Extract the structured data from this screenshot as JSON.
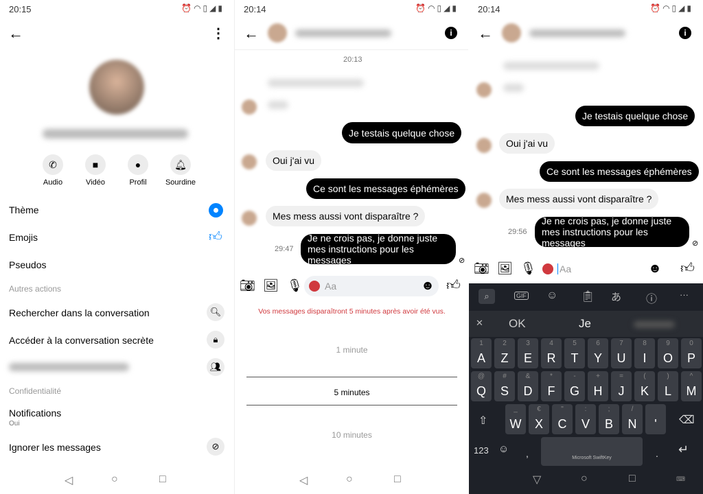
{
  "colors": {
    "accent": "#0084ff",
    "bubble_out": "#000000",
    "bubble_in": "#f0f0f0",
    "warning": "#d0393e",
    "keyboard_bg": "#1e2128"
  },
  "p1": {
    "time": "20:15",
    "actions": [
      {
        "label": "Audio",
        "icon": "phone-icon"
      },
      {
        "label": "Vidéo",
        "icon": "video-icon"
      },
      {
        "label": "Profil",
        "icon": "person-icon"
      },
      {
        "label": "Sourdine",
        "icon": "bell-icon"
      }
    ],
    "menu": {
      "theme": "Thème",
      "emojis": "Emojis",
      "pseudos": "Pseudos",
      "section_other": "Autres actions",
      "search": "Rechercher dans la conversation",
      "secret": "Accéder à la conversation secrète",
      "section_privacy": "Confidentialité",
      "notifications": "Notifications",
      "notifications_value": "Oui",
      "ignore": "Ignorer les messages"
    }
  },
  "p2": {
    "time": "20:14",
    "date_label": "20:13",
    "messages": {
      "m1": "Je testais quelque chose",
      "m2": "Oui j'ai vu",
      "m3": "Ce sont les messages éphémères",
      "m4": "Mes mess aussi vont disparaître ?",
      "m5": "Je ne crois pas, je donne juste mes instructions pour les messages"
    },
    "timer": "29:47",
    "placeholder": "Aa",
    "notice": "Vos messages disparaîtront 5 minutes après avoir été vus.",
    "options": [
      "1 minute",
      "5 minutes",
      "10 minutes"
    ],
    "selected": "5 minutes"
  },
  "p3": {
    "time": "20:14",
    "timer": "29:56",
    "placeholder": "Aa",
    "suggestions": [
      "OK",
      "Je"
    ],
    "keyboard": {
      "row1": [
        [
          "1",
          "A"
        ],
        [
          "2",
          "Z"
        ],
        [
          "3",
          "E"
        ],
        [
          "4",
          "R"
        ],
        [
          "5",
          "T"
        ],
        [
          "6",
          "Y"
        ],
        [
          "7",
          "U"
        ],
        [
          "8",
          "I"
        ],
        [
          "9",
          "O"
        ],
        [
          "0",
          "P"
        ]
      ],
      "row2": [
        [
          "@",
          "Q"
        ],
        [
          "#",
          "S"
        ],
        [
          "&",
          "D"
        ],
        [
          "*",
          "F"
        ],
        [
          "-",
          "G"
        ],
        [
          "+",
          "H"
        ],
        [
          "=",
          "J"
        ],
        [
          "(",
          "K"
        ],
        [
          ")",
          "L"
        ],
        [
          "^",
          "M"
        ]
      ],
      "row3": [
        [
          "_",
          "W"
        ],
        [
          "€",
          "X"
        ],
        [
          "\"",
          "C"
        ],
        [
          ":",
          "V"
        ],
        [
          ";",
          "B"
        ],
        [
          "/",
          "N"
        ],
        [
          "",
          "'"
        ]
      ],
      "numbers": "123",
      "space": "Microsoft SwiftKey",
      "comma": ",",
      "period": "."
    }
  }
}
